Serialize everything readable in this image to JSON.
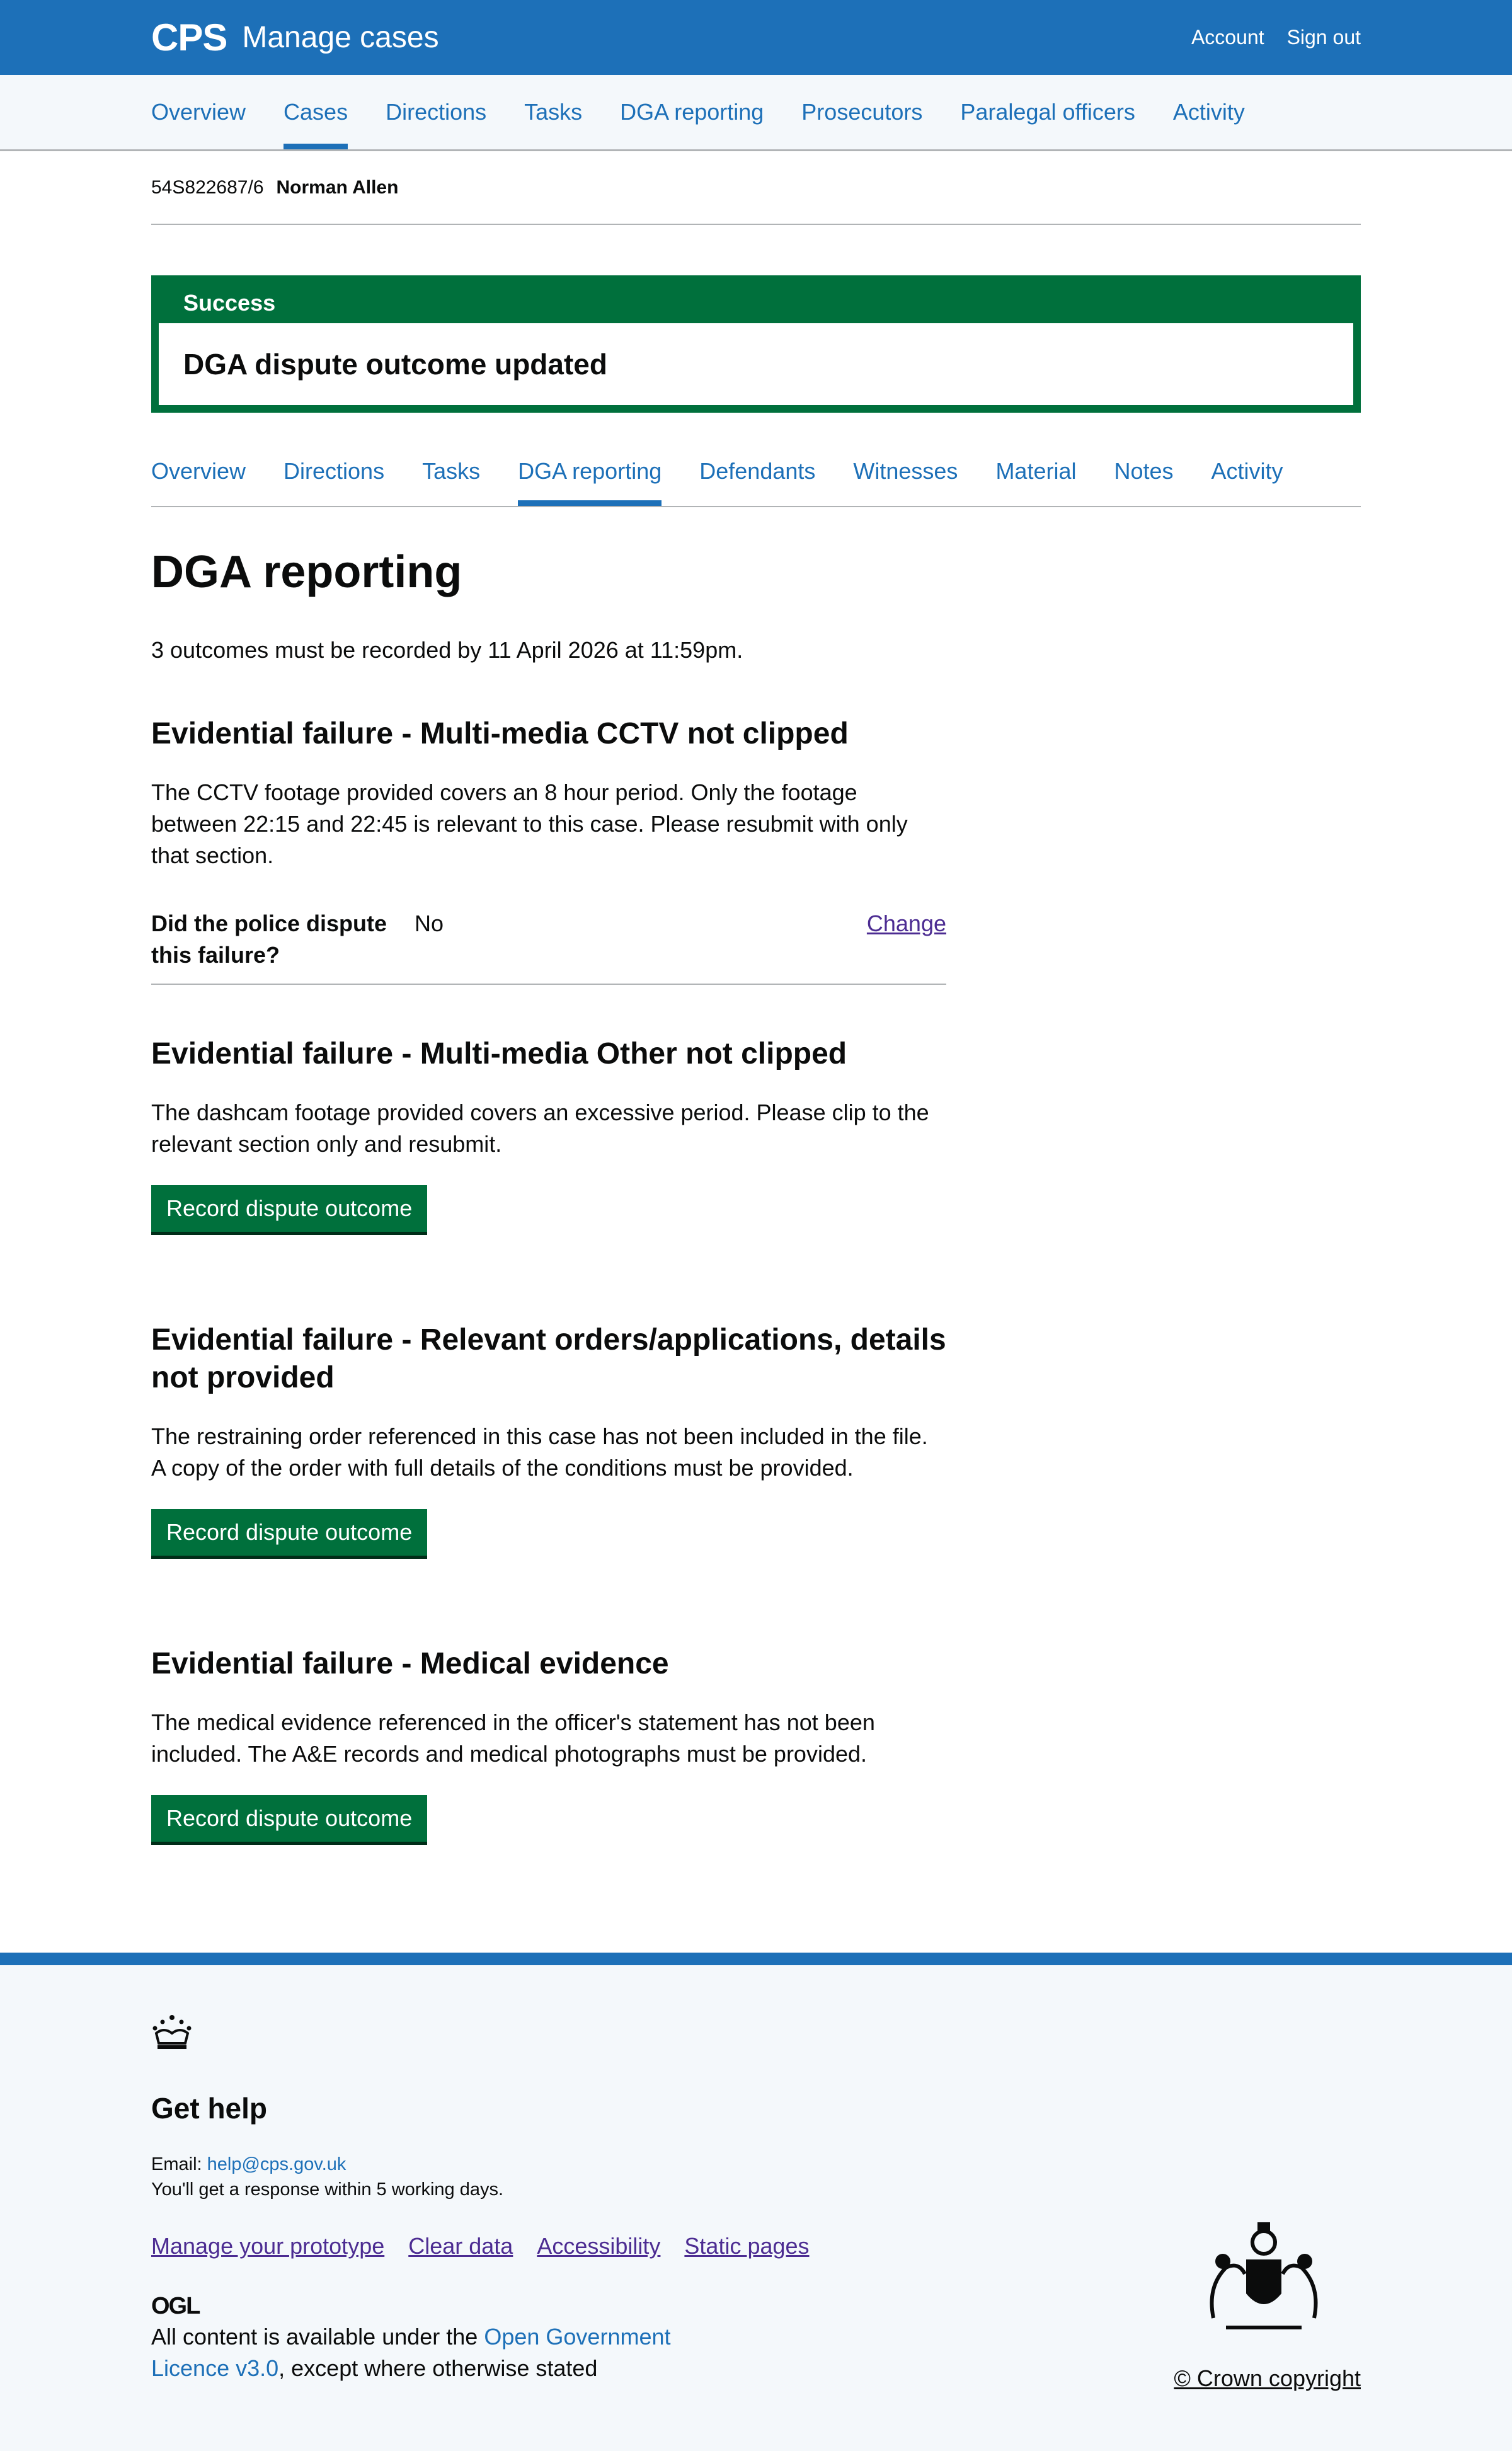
{
  "header": {
    "logo": "CPS",
    "service": "Manage cases",
    "account": "Account",
    "sign_out": "Sign out"
  },
  "primary_nav": [
    {
      "label": "Overview"
    },
    {
      "label": "Cases",
      "active": true
    },
    {
      "label": "Directions"
    },
    {
      "label": "Tasks"
    },
    {
      "label": "DGA reporting"
    },
    {
      "label": "Prosecutors"
    },
    {
      "label": "Paralegal officers"
    },
    {
      "label": "Activity"
    }
  ],
  "case": {
    "urn": "54S822687/6",
    "defendant": "Norman Allen"
  },
  "banner": {
    "title": "Success",
    "message": "DGA dispute outcome updated"
  },
  "sub_nav": [
    {
      "label": "Overview"
    },
    {
      "label": "Directions"
    },
    {
      "label": "Tasks"
    },
    {
      "label": "DGA reporting",
      "active": true
    },
    {
      "label": "Defendants"
    },
    {
      "label": "Witnesses"
    },
    {
      "label": "Material"
    },
    {
      "label": "Notes"
    },
    {
      "label": "Activity"
    }
  ],
  "page": {
    "title": "DGA reporting",
    "intro": "3 outcomes must be recorded by 11 April 2026 at 11:59pm."
  },
  "failures": [
    {
      "heading": "Evidential failure - Multi-media CCTV not clipped",
      "text": "The CCTV footage provided covers an 8 hour period. Only the footage between 22:15 and 22:45 is relevant to this case. Please resubmit with only that section.",
      "summary_key": "Did the police dispute this failure?",
      "summary_value": "No",
      "summary_action": "Change"
    },
    {
      "heading": "Evidential failure - Multi-media Other not clipped",
      "text": "The dashcam footage provided covers an excessive period. Please clip to the relevant section only and resubmit.",
      "button": "Record dispute outcome"
    },
    {
      "heading": "Evidential failure - Relevant orders/applications, details not provided",
      "text": "The restraining order referenced in this case has not been included in the file. A copy of the order with full details of the conditions must be provided.",
      "button": "Record dispute outcome"
    },
    {
      "heading": "Evidential failure - Medical evidence",
      "text": "The medical evidence referenced in the officer's statement has not been included. The A&E records and medical photographs must be provided.",
      "button": "Record dispute outcome"
    }
  ],
  "footer": {
    "get_help": "Get help",
    "email_label": "Email:",
    "email": "help@cps.gov.uk",
    "response": "You'll get a response within 5 working days.",
    "links": [
      "Manage your prototype",
      "Clear data",
      "Accessibility",
      "Static pages"
    ],
    "ogl": "OGL",
    "licence_pre": "All content is available under the",
    "licence_link": "Open Government Licence v3.0",
    "licence_post": ", except where otherwise stated",
    "copyright": "© Crown copyright"
  },
  "colors": {
    "brand_blue": "#1d70b8",
    "success_green": "#00703c",
    "visited_link": "#4c2c92"
  }
}
